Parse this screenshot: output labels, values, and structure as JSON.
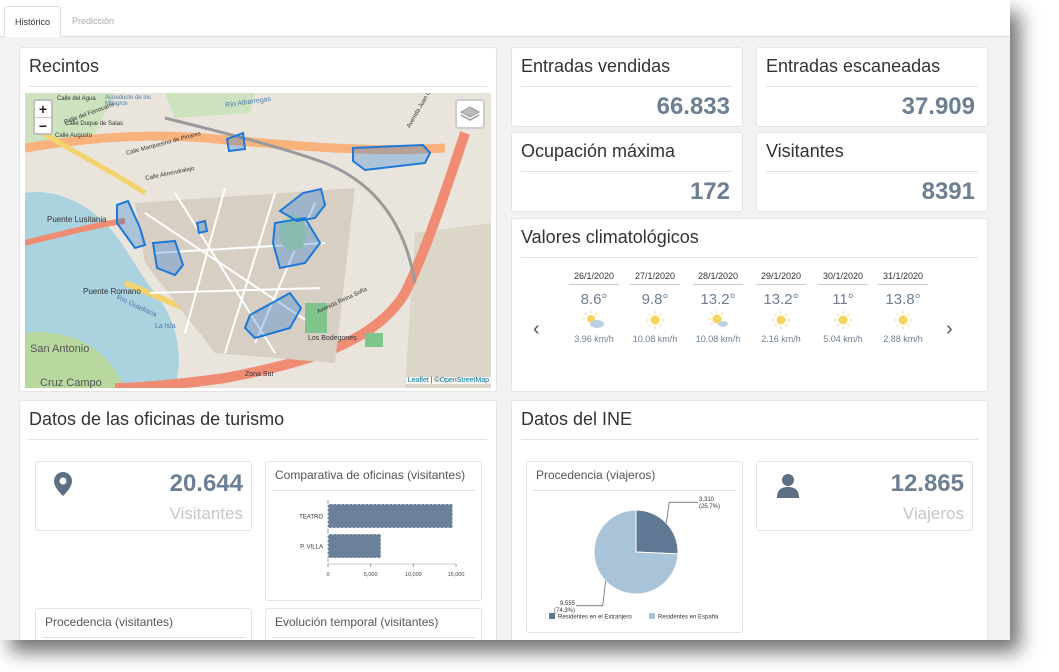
{
  "tabs": [
    {
      "label": "Histórico"
    },
    {
      "label": "Predicción"
    }
  ],
  "recintos": {
    "title": "Recintos",
    "zoom_in": "+",
    "zoom_out": "−",
    "attribution_leaflet": "Leaflet",
    "attribution_sep": " | ©",
    "attribution_osm": "OpenStreetMap",
    "labels": {
      "calle_agua": "Calle del Agua",
      "ferrocarril": "Calle del Ferrocarril",
      "calle_salas": "Calle Duque de Salas",
      "augusto": "Calle Augusto",
      "acueducto": "Acueducto de los Milagros",
      "albarregas": "Río Albarregas",
      "marquesina": "Calle Marquesina de Pinares",
      "juan_carlos": "Avenida Juan Carlos",
      "almendralejo": "Calle Almendralejo",
      "puente_lusitania": "Puente Lusitania",
      "puente_romano": "Puente Romano",
      "san_antonio": "San Antonio",
      "cruz_campo": "Cruz Campo",
      "reina_sofia": "Avenida Reina Sofía",
      "bodegones": "Los Bodegones",
      "zona_sur": "Zona Sur",
      "guadiana": "Río Guadiana",
      "isla": "La Isla"
    }
  },
  "kpis": {
    "entradas_vendidas": {
      "label": "Entradas vendidas",
      "value": "66.833"
    },
    "entradas_escaneadas": {
      "label": "Entradas escaneadas",
      "value": "37.909"
    },
    "ocupacion": {
      "label": "Ocupación máxima",
      "value": "172"
    },
    "visitantes": {
      "label": "Visitantes",
      "value": "8391"
    }
  },
  "clima": {
    "title": "Valores climatológicos",
    "prev": "‹",
    "next": "›",
    "days": [
      {
        "date": "26/1/2020",
        "temp": "8.6°",
        "wind": "3.96 km/h",
        "icon": "partly-cloudy-icon"
      },
      {
        "date": "27/1/2020",
        "temp": "9.8°",
        "wind": "10.08 km/h",
        "icon": "sun-icon"
      },
      {
        "date": "28/1/2020",
        "temp": "13.2°",
        "wind": "10.08 km/h",
        "icon": "sun-cloud-icon"
      },
      {
        "date": "29/1/2020",
        "temp": "13.2°",
        "wind": "2.16 km/h",
        "icon": "sun-icon"
      },
      {
        "date": "30/1/2020",
        "temp": "11°",
        "wind": "5.04 km/h",
        "icon": "sun-icon"
      },
      {
        "date": "31/1/2020",
        "temp": "13.8°",
        "wind": "2.88 km/h",
        "icon": "sun-icon"
      }
    ]
  },
  "turismo": {
    "title": "Datos de las oficinas de turismo",
    "visitantes_value": "20.644",
    "visitantes_label": "Visitantes",
    "comparativa_title": "Comparativa de oficinas (visitantes)",
    "procedencia_title": "Procedencia (visitantes)",
    "evolucion_title": "Evolución temporal (visitantes)"
  },
  "ine": {
    "title": "Datos del INE",
    "procedencia_title": "Procedencia (viajeros)",
    "viajeros_value": "12.865",
    "viajeros_label": "Viajeros"
  },
  "colors": {
    "bar": "#6b8099",
    "pie_ext": "#5f7893",
    "pie_esp": "#a9c3d9",
    "kpi": "#6c7f93",
    "polygon": "#1e78d7"
  },
  "chart_data": [
    {
      "type": "bar",
      "orientation": "horizontal",
      "categories": [
        "TEATRO",
        "P. VILLA"
      ],
      "values": [
        14600,
        6200
      ],
      "xlim": [
        0,
        15000
      ],
      "xticks": [
        "0",
        "5,000",
        "10,000",
        "15,000"
      ],
      "title": "Comparativa de oficinas (visitantes)"
    },
    {
      "type": "pie",
      "title": "Procedencia (viajeros)",
      "slices": [
        {
          "name": "Residentes en el Extranjero",
          "value": 3310,
          "label": "3,310",
          "pct": "(25.7%)"
        },
        {
          "name": "Residentes en España",
          "value": 9555,
          "label": "9,555",
          "pct": "(74.3%)"
        }
      ]
    }
  ]
}
